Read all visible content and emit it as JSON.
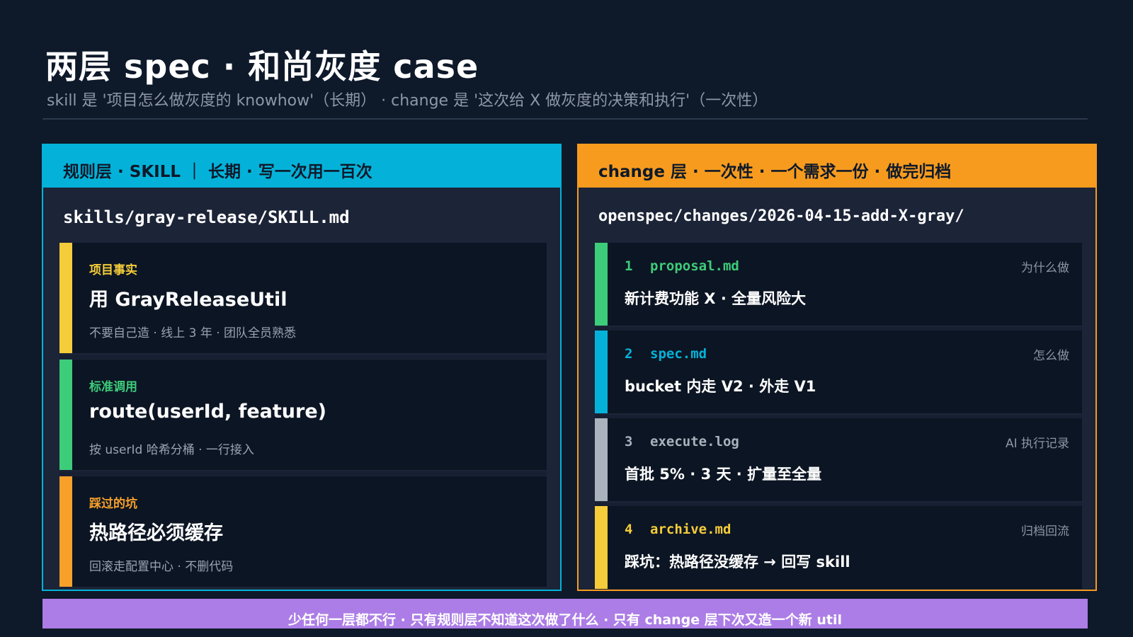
{
  "title": "两层 spec · 和尚灰度 case",
  "subtitle": "skill 是 '项目怎么做灰度的 knowhow'（长期） · change 是 '这次给 X 做灰度的决策和执行'（一次性）",
  "colors": {
    "background": "#0e192a",
    "skill_accent": "#04b2d9",
    "change_accent": "#f79b1e",
    "yellow": "#f5cc3a",
    "green": "#3dcc7a",
    "orange": "#f7a12b",
    "gray": "#aab2be",
    "footer": "#ac7de6"
  },
  "skill_panel": {
    "header": "规则层 · SKILL ｜ 长期 · 写一次用一百次",
    "path": "skills/gray-release/SKILL.md",
    "cards": [
      {
        "tag": "项目事实",
        "head": "用 GrayReleaseUtil",
        "note": "不要自己造 · 线上 3 年 · 团队全员熟悉",
        "color": "#f5cc3a"
      },
      {
        "tag": "标准调用",
        "head": "route(userId, feature)",
        "note": "按 userId 哈希分桶 · 一行接入",
        "color": "#3dcc7a"
      },
      {
        "tag": "踩过的坑",
        "head": "热路径必须缓存",
        "note": "回滚走配置中心 · 不删代码",
        "color": "#f7a12b"
      }
    ]
  },
  "change_panel": {
    "header": "change 层 · 一次性 · 一个需求一份 · 做完归档",
    "path": "openspec/changes/2026-04-15-add-X-gray/",
    "cards": [
      {
        "num": "1",
        "file": "proposal.md",
        "side": "为什么做",
        "desc": "新计费功能 X · 全量风险大",
        "color": "#3dcc7a"
      },
      {
        "num": "2",
        "file": "spec.md",
        "side": "怎么做",
        "desc": "bucket 内走 V2 · 外走 V1",
        "color": "#04b2d9"
      },
      {
        "num": "3",
        "file": "execute.log",
        "side": "AI 执行记录",
        "desc": "首批 5% · 3 天 · 扩量至全量",
        "color": "#aab2be"
      },
      {
        "num": "4",
        "file": "archive.md",
        "side": "归档回流",
        "desc": "踩坑：热路径没缓存 → 回写 skill",
        "color": "#f5cc3a"
      }
    ]
  },
  "footer": "少任何一层都不行 · 只有规则层不知道这次做了什么 · 只有 change 层下次又造一个新 util"
}
